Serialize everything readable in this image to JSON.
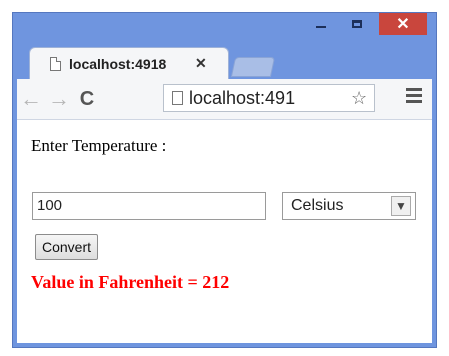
{
  "window": {
    "minimize_icon": "minimize-icon",
    "maximize_icon": "maximize-icon",
    "close_glyph": "✕"
  },
  "tab": {
    "title": "localhost:4918",
    "close_glyph": "✕"
  },
  "toolbar": {
    "back_glyph": "←",
    "forward_glyph": "→",
    "reload_glyph": "C",
    "url": "localhost:491",
    "star_glyph": "☆"
  },
  "form": {
    "label": "Enter Temperature :",
    "temperature_value": "100",
    "unit_selected": "Celsius",
    "unit_arrow": "▼",
    "convert_label": "Convert"
  },
  "result": {
    "text": "Value in Fahrenheit = 212",
    "color": "#ff0000"
  }
}
